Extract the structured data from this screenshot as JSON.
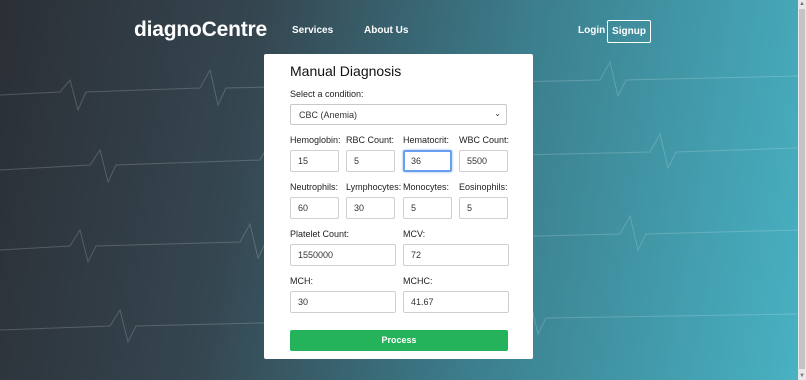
{
  "nav": {
    "brand": "diagnoCentre",
    "services": "Services",
    "about": "About Us",
    "login": "Login",
    "signup": "Signup"
  },
  "form": {
    "title": "Manual Diagnosis",
    "select_label": "Select a condition:",
    "condition": "CBC (Anemia)",
    "fields": {
      "hemoglobin": {
        "label": "Hemoglobin:",
        "value": "15"
      },
      "rbc": {
        "label": "RBC Count:",
        "value": "5"
      },
      "hematocrit": {
        "label": "Hematocrit:",
        "value": "36"
      },
      "wbc": {
        "label": "WBC Count:",
        "value": "5500"
      },
      "neutrophils": {
        "label": "Neutrophils:",
        "value": "60"
      },
      "lymphocytes": {
        "label": "Lymphocytes:",
        "value": "30"
      },
      "monocytes": {
        "label": "Monocytes:",
        "value": "5"
      },
      "eosinophils": {
        "label": "Eosinophils:",
        "value": "5"
      },
      "platelet": {
        "label": "Platelet Count:",
        "value": "1550000"
      },
      "mcv": {
        "label": "MCV:",
        "value": "72"
      },
      "mch": {
        "label": "MCH:",
        "value": "30"
      },
      "mchc": {
        "label": "MCHC:",
        "value": "41.67"
      }
    },
    "process": "Process"
  }
}
